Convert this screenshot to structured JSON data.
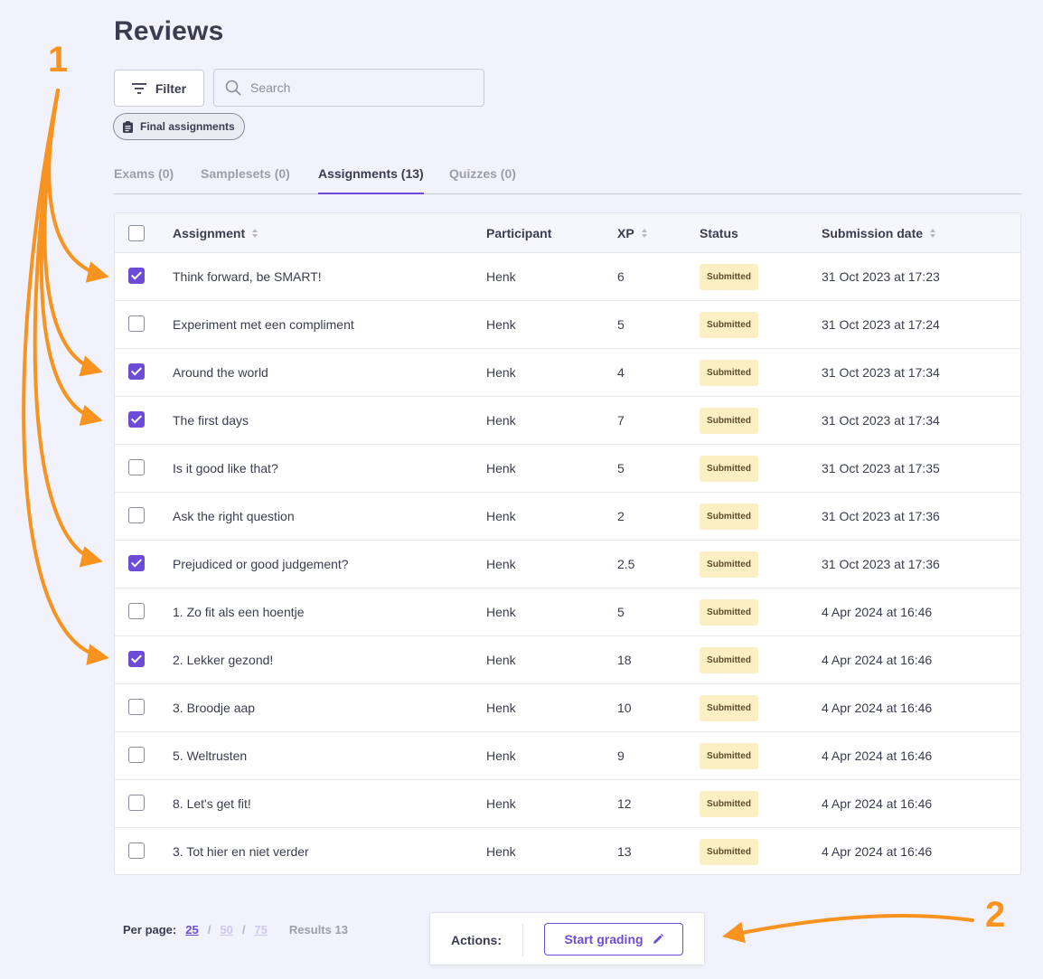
{
  "page": {
    "title": "Reviews"
  },
  "toolbar": {
    "filter_label": "Filter",
    "search_placeholder": "Search",
    "chip_label": "Final assignments"
  },
  "tabs": [
    {
      "label": "Exams (0)",
      "active": false
    },
    {
      "label": "Samplesets (0)",
      "active": false
    },
    {
      "label": "Assignments (13)",
      "active": true
    },
    {
      "label": "Quizzes (0)",
      "active": false
    }
  ],
  "table": {
    "columns": {
      "assignment": "Assignment",
      "participant": "Participant",
      "xp": "XP",
      "status": "Status",
      "submission_date": "Submission date"
    },
    "rows": [
      {
        "checked": true,
        "assignment": "Think forward, be SMART!",
        "participant": "Henk",
        "xp": "6",
        "status": "Submitted",
        "date": "31 Oct 2023 at 17:23"
      },
      {
        "checked": false,
        "assignment": "Experiment met een compliment",
        "participant": "Henk",
        "xp": "5",
        "status": "Submitted",
        "date": "31 Oct 2023 at 17:24"
      },
      {
        "checked": true,
        "assignment": "Around the world",
        "participant": "Henk",
        "xp": "4",
        "status": "Submitted",
        "date": "31 Oct 2023 at 17:34"
      },
      {
        "checked": true,
        "assignment": "The first days",
        "participant": "Henk",
        "xp": "7",
        "status": "Submitted",
        "date": "31 Oct 2023 at 17:34"
      },
      {
        "checked": false,
        "assignment": "Is it good like that?",
        "participant": "Henk",
        "xp": "5",
        "status": "Submitted",
        "date": "31 Oct 2023 at 17:35"
      },
      {
        "checked": false,
        "assignment": "Ask the right question",
        "participant": "Henk",
        "xp": "2",
        "status": "Submitted",
        "date": "31 Oct 2023 at 17:36"
      },
      {
        "checked": true,
        "assignment": "Prejudiced or good judgement?",
        "participant": "Henk",
        "xp": "2.5",
        "status": "Submitted",
        "date": "31 Oct 2023 at 17:36"
      },
      {
        "checked": false,
        "assignment": "1. Zo fit als een hoentje",
        "participant": "Henk",
        "xp": "5",
        "status": "Submitted",
        "date": "4 Apr 2024 at 16:46"
      },
      {
        "checked": true,
        "assignment": "2. Lekker gezond!",
        "participant": "Henk",
        "xp": "18",
        "status": "Submitted",
        "date": "4 Apr 2024 at 16:46"
      },
      {
        "checked": false,
        "assignment": "3. Broodje aap",
        "participant": "Henk",
        "xp": "10",
        "status": "Submitted",
        "date": "4 Apr 2024 at 16:46"
      },
      {
        "checked": false,
        "assignment": "5. Weltrusten",
        "participant": "Henk",
        "xp": "9",
        "status": "Submitted",
        "date": "4 Apr 2024 at 16:46"
      },
      {
        "checked": false,
        "assignment": "8. Let's get fit!",
        "participant": "Henk",
        "xp": "12",
        "status": "Submitted",
        "date": "4 Apr 2024 at 16:46"
      },
      {
        "checked": false,
        "assignment": "3. Tot hier en niet verder",
        "participant": "Henk",
        "xp": "13",
        "status": "Submitted",
        "date": "4 Apr 2024 at 16:46"
      }
    ]
  },
  "pagination": {
    "per_page_label": "Per page:",
    "options": [
      "25",
      "50",
      "75"
    ],
    "separator": "/",
    "results_label": "Results 13"
  },
  "actions": {
    "label": "Actions:",
    "start_grading": "Start grading"
  },
  "annotations": {
    "marker_1": "1",
    "marker_2": "2"
  },
  "colors": {
    "accent": "#6e4bd6",
    "annotation": "#f7931e",
    "badge_bg": "#fcefc4",
    "background": "#f1f2fc"
  }
}
